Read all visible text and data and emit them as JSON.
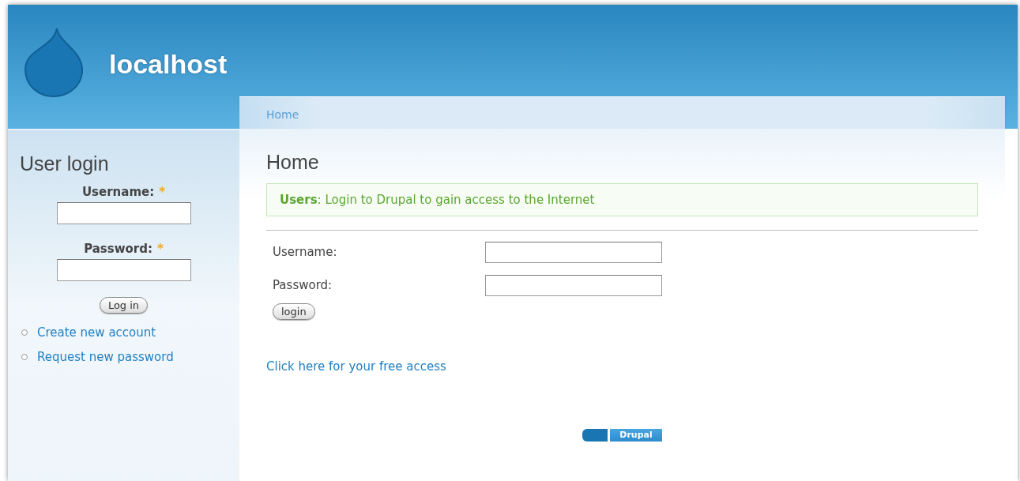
{
  "site": {
    "name": "localhost"
  },
  "breadcrumb": [
    {
      "label": "Home"
    }
  ],
  "sidebar": {
    "title": "User login",
    "fields": [
      {
        "label": "Username:",
        "required_mark": "*"
      },
      {
        "label": "Password:",
        "required_mark": "*"
      }
    ],
    "button": "Log in",
    "links": [
      {
        "label": "Create new account"
      },
      {
        "label": "Request new password"
      }
    ]
  },
  "content": {
    "title": "Home",
    "message": "**Users**: Login to Drupal to gain access to the Internet",
    "form": {
      "fields": [
        {
          "label": "Username:"
        },
        {
          "label": "Password:"
        }
      ],
      "button": "login"
    },
    "link": "Click here for your free access"
  },
  "footer": {
    "badge": "Drupal"
  }
}
